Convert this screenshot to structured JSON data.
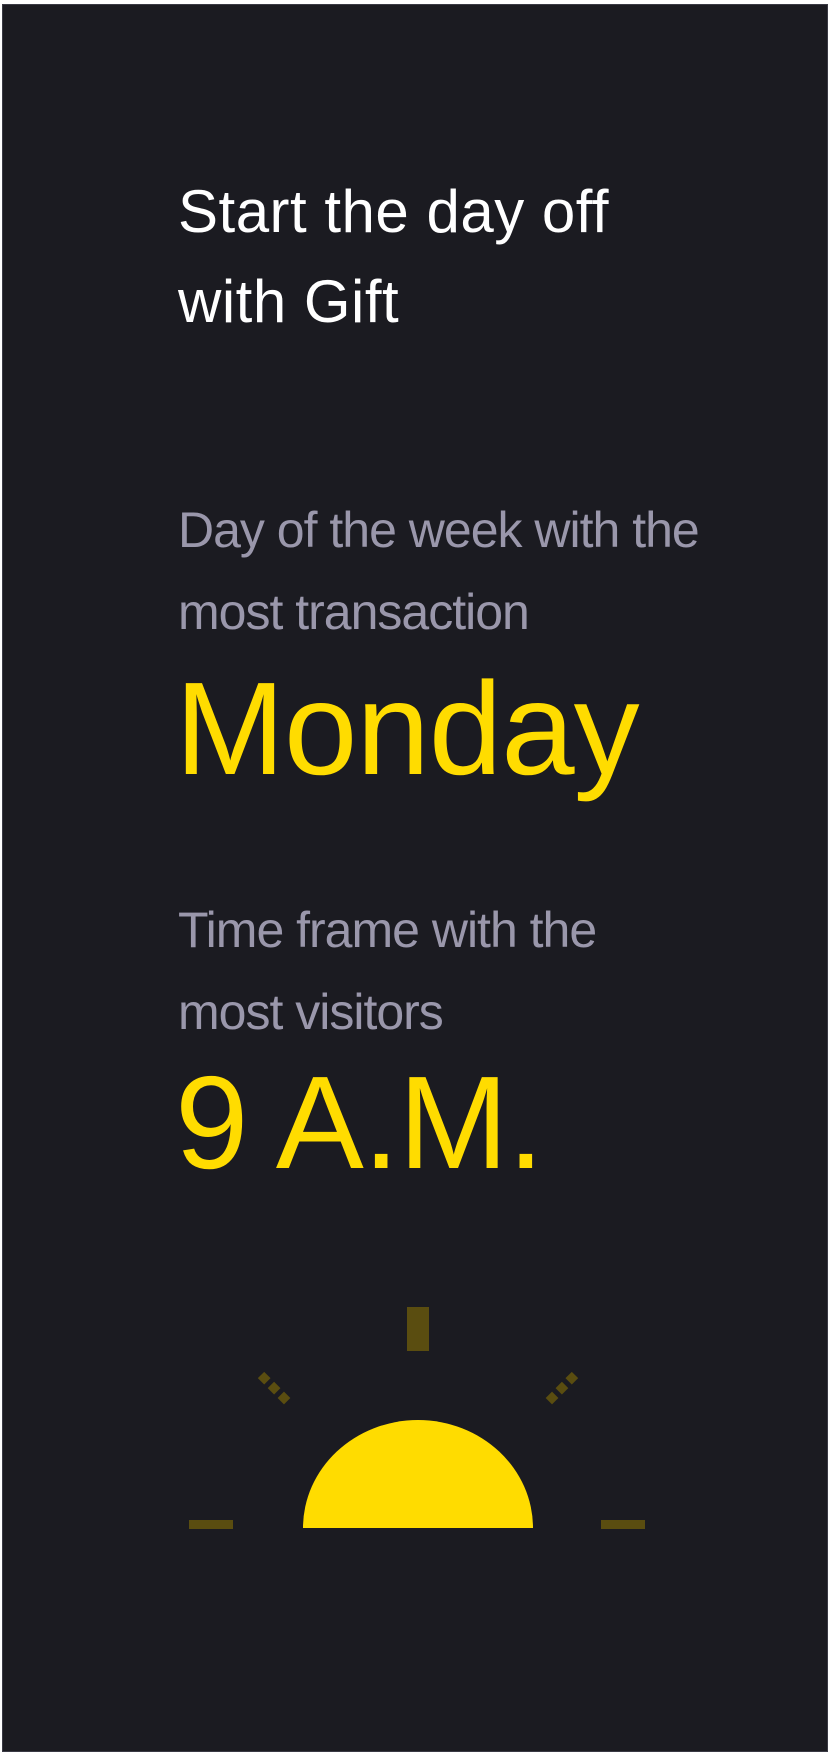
{
  "title": {
    "line1": "Start the day off",
    "line2": "with Gift"
  },
  "busiest_day": {
    "label_line1": "Day of the week with the",
    "label_line2": "most transaction",
    "value": "Monday"
  },
  "busiest_time": {
    "label_line1": "Time frame with the",
    "label_line2": "most visitors",
    "value": "9 A.M."
  },
  "illustration": {
    "icon": "sunrise-icon"
  },
  "colors": {
    "background": "#1b1b21",
    "title": "#ffffff",
    "label": "#9a97ab",
    "accent": "#ffdc00",
    "ray": "#5a4d10"
  }
}
